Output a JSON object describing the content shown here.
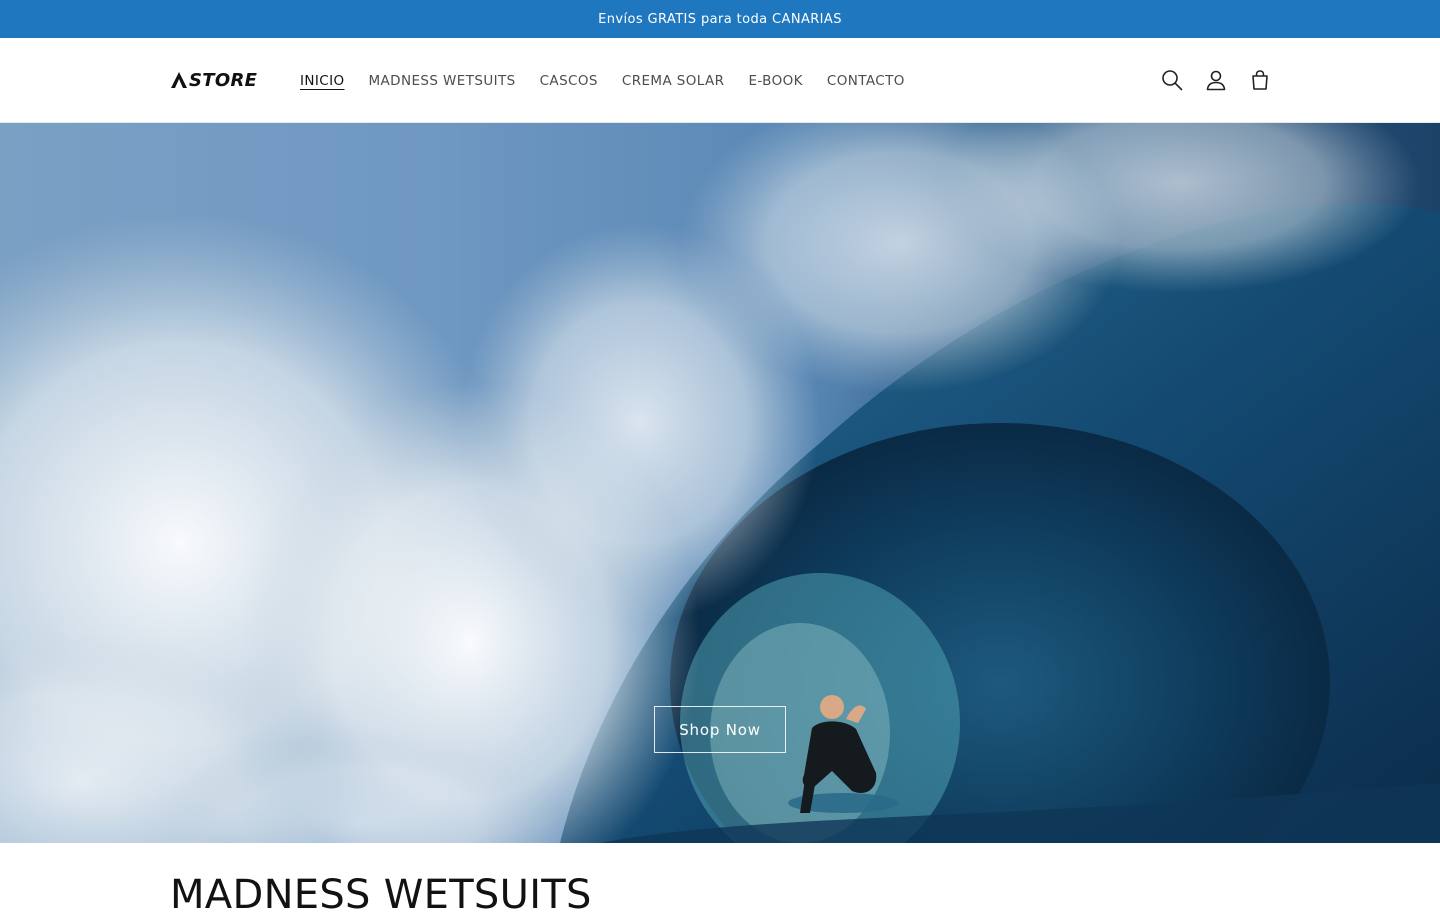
{
  "announcement": {
    "text": "Envíos GRATIS para toda CANARIAS"
  },
  "header": {
    "logo_text": "STORE",
    "nav": [
      {
        "label": "INICIO",
        "active": true
      },
      {
        "label": "MADNESS WETSUITS"
      },
      {
        "label": "CASCOS"
      },
      {
        "label": "CREMA SOLAR"
      },
      {
        "label": "E-BOOK"
      },
      {
        "label": "CONTACTO"
      }
    ],
    "icons": [
      "search-icon",
      "account-icon",
      "cart-icon"
    ]
  },
  "hero": {
    "button_label": "Shop Now"
  },
  "section": {
    "title": "MADNESS WETSUITS"
  },
  "colors": {
    "announcement_bg": "#1f77bf",
    "text": "#121212",
    "nav_text": "#4d4d4d"
  }
}
